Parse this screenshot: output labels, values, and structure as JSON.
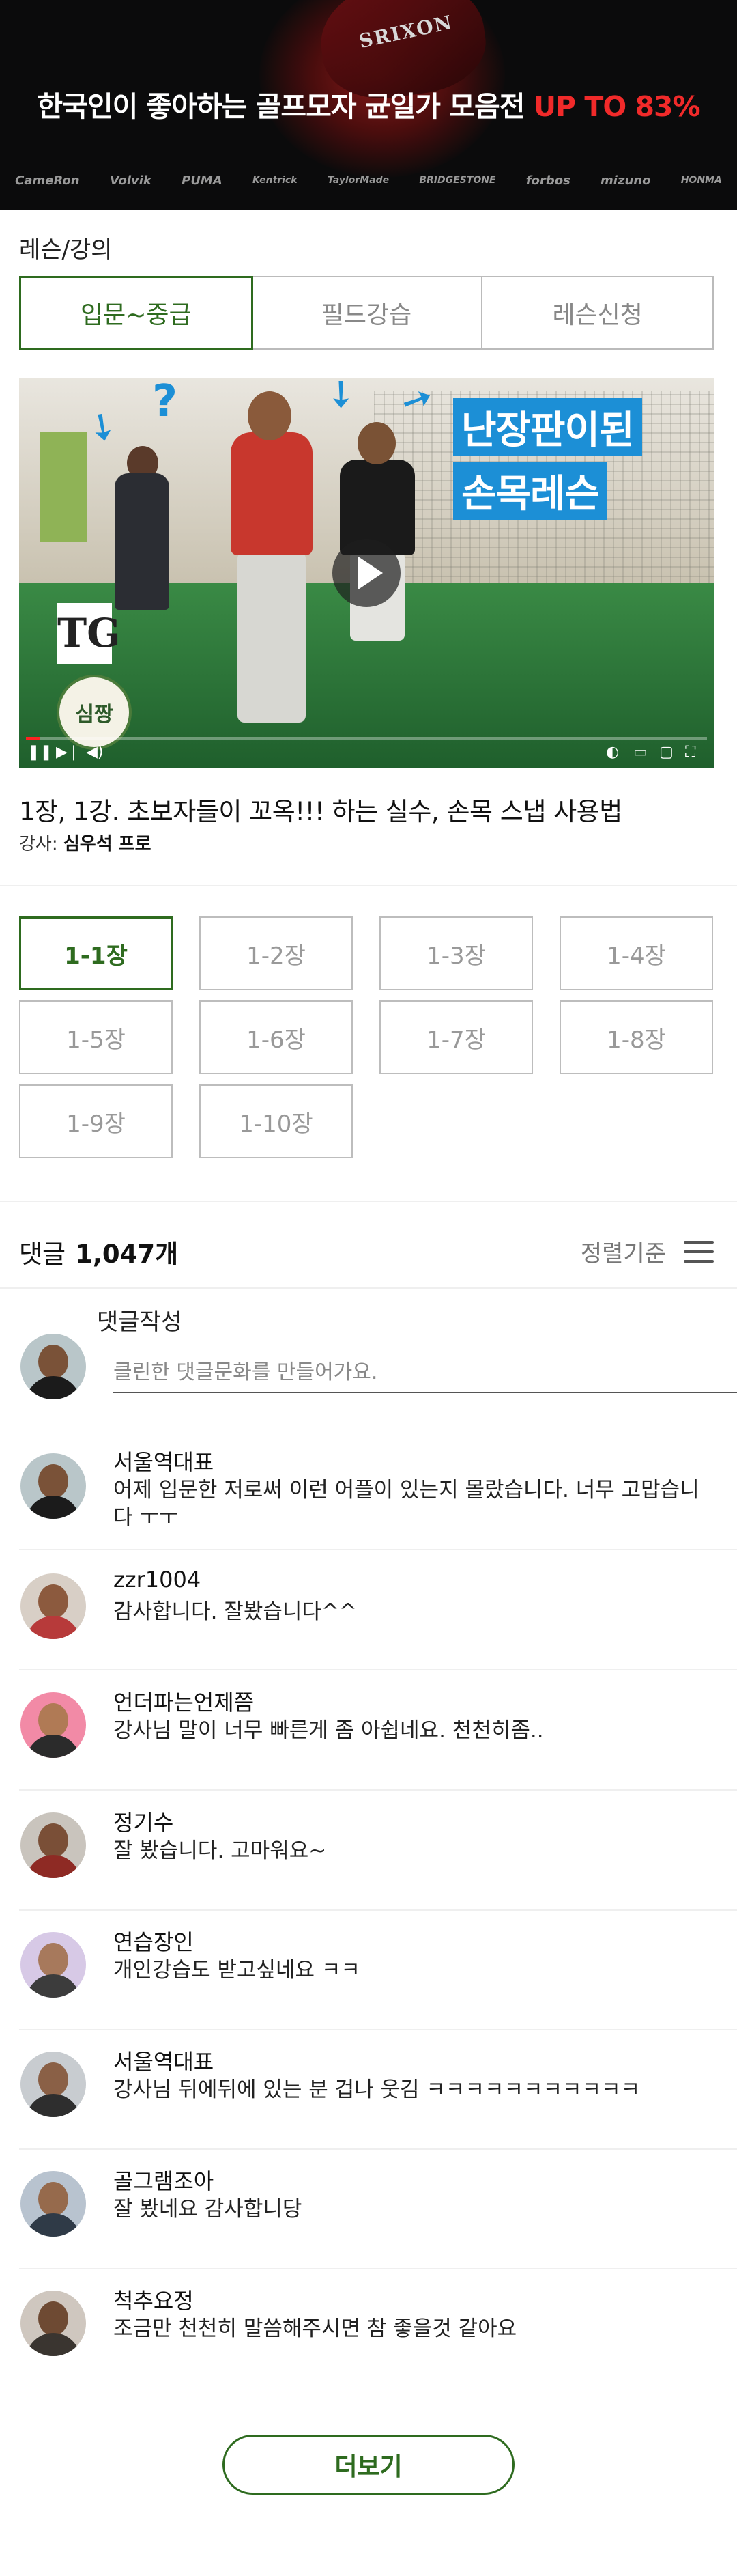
{
  "banner": {
    "headline_main": "한국인이 좋아하는 골프모자 균일가 모음전 ",
    "headline_highlight": "UP TO 83%",
    "cap_text": "SRIXON",
    "brands": [
      "CameRon",
      "Volvik",
      "PUMA",
      "Kentrick",
      "TaylorMade",
      "BRIDGESTONE",
      "forbos",
      "mizuno",
      "HONMA"
    ]
  },
  "section": {
    "title": "레슨/강의"
  },
  "tabs": [
    {
      "label": "입문~중급",
      "active": true
    },
    {
      "label": "필드강습",
      "active": false
    },
    {
      "label": "레슨신청",
      "active": false
    }
  ],
  "video": {
    "overlay_title_line1": "난장판이된",
    "overlay_title_line2": "손목레슨",
    "logo_text": "TG",
    "seal_text": "심짱",
    "progress": 0.02
  },
  "lesson": {
    "title": "1장, 1강. 초보자들이 꼬옥!!! 하는 실수, 손목 스냅 사용법",
    "instructor_label": "강사: ",
    "instructor_name": "심우석 프로"
  },
  "chapters": [
    {
      "label": "1-1장",
      "active": true
    },
    {
      "label": "1-2장",
      "active": false
    },
    {
      "label": "1-3장",
      "active": false
    },
    {
      "label": "1-4장",
      "active": false
    },
    {
      "label": "1-5장",
      "active": false
    },
    {
      "label": "1-6장",
      "active": false
    },
    {
      "label": "1-7장",
      "active": false
    },
    {
      "label": "1-8장",
      "active": false
    },
    {
      "label": "1-9장",
      "active": false
    },
    {
      "label": "1-10장",
      "active": false
    }
  ],
  "comments_header": {
    "label": "댓글",
    "count": "1,047개",
    "sort_label": "정렬기준"
  },
  "write": {
    "label": "댓글작성",
    "placeholder": "클린한 댓글문화를 만들어가요."
  },
  "comments": [
    {
      "name": "서울역대표",
      "text": "어제 입문한 저로써 이런 어플이 있는지 몰랐습니다. 너무 고맙습니다 ㅜㅜ"
    },
    {
      "name": "zzr1004",
      "text": "감사합니다. 잘봤습니다^^"
    },
    {
      "name": "언더파는언제쯤",
      "text": "강사님 말이 너무 빠른게 좀 아쉽네요. 천천히좀.."
    },
    {
      "name": "정기수",
      "text": "잘 봤습니다. 고마워요~"
    },
    {
      "name": "연습장인",
      "text": "개인강습도 받고싶네요 ㅋㅋ"
    },
    {
      "name": "서울역대표",
      "text": "강사님 뒤에뒤에 있는 분 겁나 웃김 ㅋㅋㅋㅋㅋㅋㅋㅋㅋㅋㅋ"
    },
    {
      "name": "골그램조아",
      "text": "잘 봤네요 감사합니당"
    },
    {
      "name": "척추요정",
      "text": "조금만 천천히 말씀해주시면 참 좋을것 같아요"
    }
  ],
  "more_button": {
    "label": "더보기"
  },
  "colors": {
    "accent": "#2e6b1f",
    "highlight": "#f12a2a",
    "video_title_bg": "#1c8fd6"
  }
}
